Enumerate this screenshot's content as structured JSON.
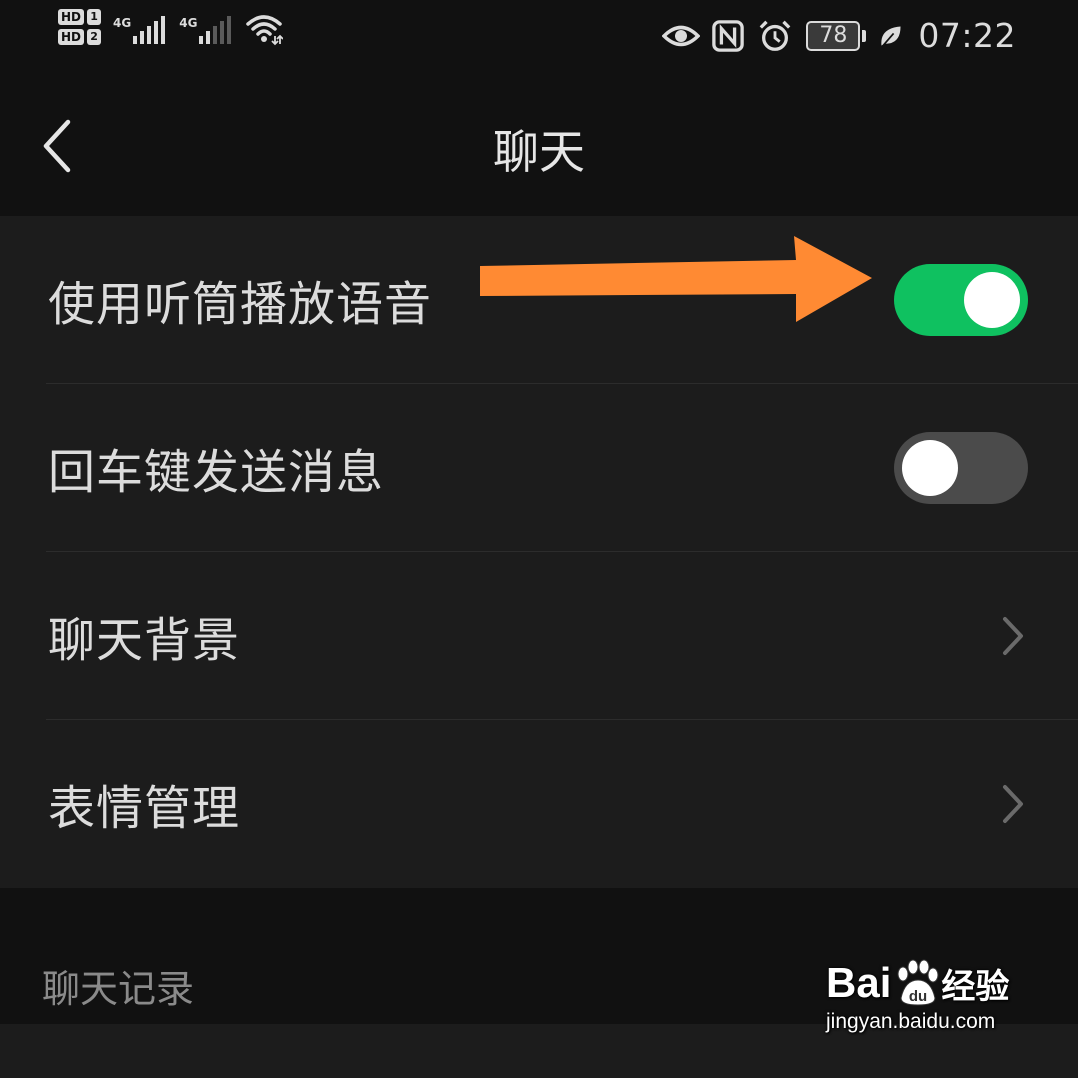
{
  "status_bar": {
    "sim1": {
      "hd": "HD",
      "slot": "1",
      "network": "4G"
    },
    "sim2": {
      "hd": "HD",
      "slot": "2",
      "network": "4G"
    },
    "battery_level": "78",
    "time": "07:22",
    "icons": [
      "eye-icon",
      "nfc-icon",
      "alarm-icon",
      "battery-icon",
      "leaf-icon",
      "wifi-icon",
      "signal-icon"
    ]
  },
  "header": {
    "title": "聊天",
    "back_icon": "chevron-left-icon"
  },
  "settings": {
    "items": [
      {
        "label": "使用听筒播放语音",
        "control": "toggle",
        "on": true
      },
      {
        "label": "回车键发送消息",
        "control": "toggle",
        "on": false
      },
      {
        "label": "聊天背景",
        "control": "chevron"
      },
      {
        "label": "表情管理",
        "control": "chevron"
      }
    ]
  },
  "section": {
    "label": "聊天记录"
  },
  "watermark": {
    "brand": "Bai",
    "brand_tail": "经验",
    "url": "jingyan.baidu.com"
  },
  "colors": {
    "background": "#111111",
    "list_background": "#1c1c1c",
    "toggle_on": "#0fc160",
    "toggle_off": "#4b4b4b",
    "annotation_arrow": "#ff8a33",
    "text_primary": "#dcdcdc",
    "text_secondary": "#8a8a8a"
  }
}
